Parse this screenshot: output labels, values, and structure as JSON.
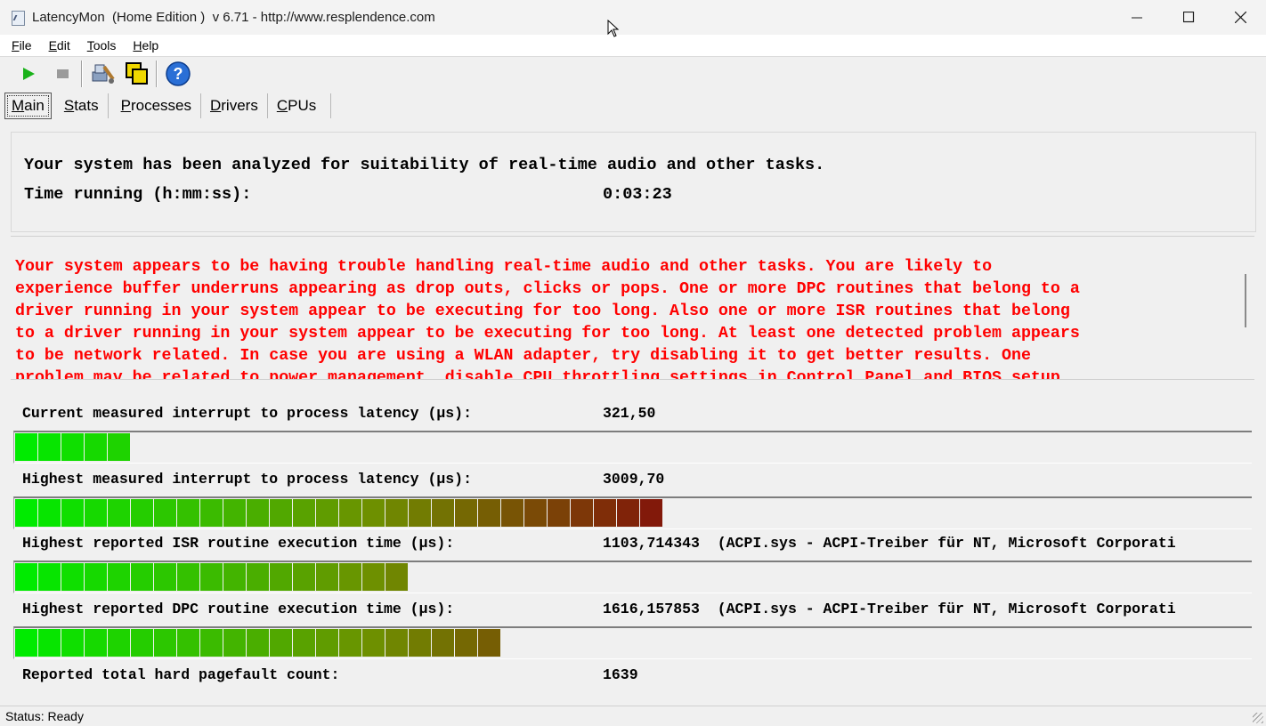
{
  "window": {
    "title": "LatencyMon  (Home Edition )  v 6.71 - http://www.resplendence.com"
  },
  "menu": [
    {
      "label": "File",
      "underline": "F",
      "rest": "ile"
    },
    {
      "label": "Edit",
      "underline": "E",
      "rest": "dit"
    },
    {
      "label": "Tools",
      "underline": "T",
      "rest": "ools"
    },
    {
      "label": "Help",
      "underline": "H",
      "rest": "elp"
    }
  ],
  "toolbar": {
    "start_icon": "play-icon",
    "stop_icon": "stop-icon",
    "drivers_icon": "drivers-tool-icon",
    "windows_icon": "windows-icon",
    "help_icon": "help-icon"
  },
  "tabs": [
    {
      "label": "Main",
      "u": "M",
      "rest": "ain"
    },
    {
      "label": "Stats",
      "u": "S",
      "rest": "tats"
    },
    {
      "label": "Processes",
      "u": "P",
      "rest": "rocesses"
    },
    {
      "label": "Drivers",
      "u": "D",
      "rest": "rivers"
    },
    {
      "label": "CPUs",
      "u": "C",
      "rest": "PUs"
    }
  ],
  "summary": {
    "line1": "Your system has been analyzed for suitability of real-time audio and other tasks.",
    "time_label": "Time running (h:mm:ss):",
    "time_value": "0:03:23"
  },
  "warning": {
    "text": "Your system appears to be having trouble handling real-time audio and other tasks. You are likely to\nexperience buffer underruns appearing as drop outs, clicks or pops. One or more DPC routines that belong to a\ndriver running in your system appear to be executing for too long. Also one or more ISR routines that belong\nto a driver running in your system appear to be executing for too long. At least one detected problem appears\nto be network related. In case you are using a WLAN adapter, try disabling it to get better results. One\nproblem may be related to power management, disable CPU throttling settings in Control Panel and BIOS setup."
  },
  "metrics": [
    {
      "label": "Current measured interrupt to process latency (µs):",
      "value": "321,50",
      "detail": "",
      "segments": 5
    },
    {
      "label": "Highest measured interrupt to process latency (µs):",
      "value": "3009,70",
      "detail": "",
      "segments": 28
    },
    {
      "label": "Highest reported ISR routine execution time (µs):",
      "value": "1103,714343",
      "detail": "(ACPI.sys - ACPI-Treiber für NT, Microsoft Corporati",
      "segments": 17
    },
    {
      "label": "Highest reported DPC routine execution time (µs):",
      "value": "1616,157853",
      "detail": "(ACPI.sys - ACPI-Treiber für NT, Microsoft Corporati",
      "segments": 21
    },
    {
      "label": "Reported total hard pagefault count:",
      "value": "1639",
      "detail": ""
    }
  ],
  "status": {
    "text": "Status: Ready"
  }
}
